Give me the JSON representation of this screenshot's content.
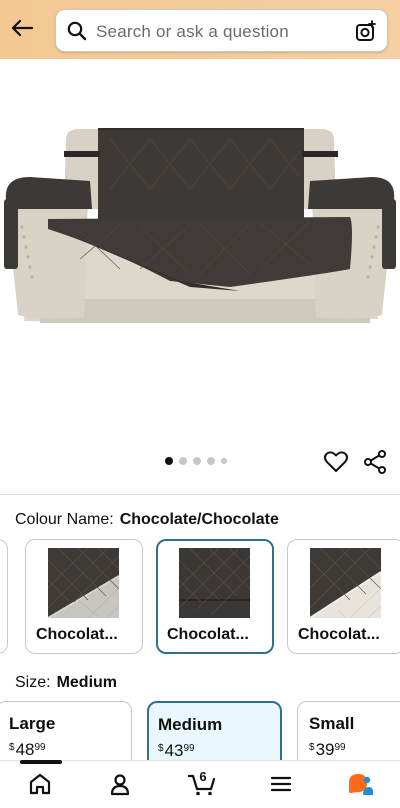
{
  "header": {
    "search_placeholder": "Search or ask a question"
  },
  "gallery": {
    "image_count": 5,
    "active_index": 0
  },
  "colour": {
    "label": "Colour Name:",
    "value": "Chocolate/Chocolate",
    "options": [
      {
        "label": "Chocolat..."
      },
      {
        "label": "Chocolat..."
      },
      {
        "label": "Chocolat..."
      }
    ]
  },
  "size": {
    "label": "Size:",
    "value": "Medium",
    "options": [
      {
        "name": "Large",
        "currency": "$",
        "whole": "48",
        "fraction": "99"
      },
      {
        "name": "Medium",
        "currency": "$",
        "whole": "43",
        "fraction": "99"
      },
      {
        "name": "Small",
        "currency": "$",
        "whole": "39",
        "fraction": "99"
      }
    ]
  },
  "bottom_nav": {
    "cart_count": "6",
    "items": [
      "home-icon",
      "account-icon",
      "cart-icon",
      "menu-icon",
      "assistant-icon"
    ]
  },
  "colors": {
    "header_bg": "#f3c892",
    "selected_border": "#2f6f8f",
    "selected_fill": "#eaf8fd",
    "cover": "#3b3735",
    "couch": "#d9d2c7"
  }
}
